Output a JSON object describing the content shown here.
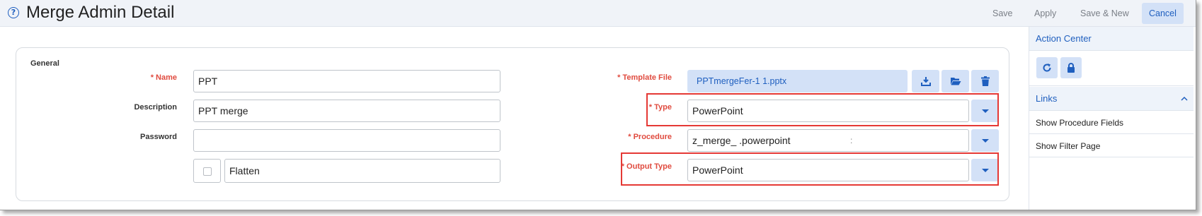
{
  "header": {
    "title": "Merge Admin Detail",
    "help_icon": "help-circle-icon",
    "buttons": {
      "save": "Save",
      "apply": "Apply",
      "save_new": "Save & New",
      "cancel": "Cancel"
    }
  },
  "general": {
    "section_title": "General",
    "name": {
      "label": "* Name",
      "value": "PPT"
    },
    "description": {
      "label": "Description",
      "value": "PPT merge"
    },
    "password": {
      "label": "Password",
      "value": ""
    },
    "flatten": {
      "label": "Flatten",
      "checked": false
    }
  },
  "template": {
    "template_file": {
      "label": "* Template File",
      "value": "PPTmergeFer-1 1.pptx"
    },
    "type": {
      "label": "* Type",
      "value": "PowerPoint"
    },
    "procedure": {
      "label": "* Procedure",
      "value": "z_merge_ .powerpoint",
      "suffix": ":"
    },
    "output_type": {
      "label": "* Output Type",
      "value": "PowerPoint"
    },
    "file_actions": [
      "download-icon",
      "folder-open-icon",
      "trash-icon"
    ]
  },
  "action_center": {
    "title": "Action Center",
    "buttons": [
      "refresh-icon",
      "lock-icon"
    ]
  },
  "links": {
    "title": "Links",
    "items": [
      "Show Procedure Fields",
      "Show Filter Page"
    ]
  },
  "colors": {
    "accent": "#1f5fbf",
    "accent_light": "#d3e1f7",
    "required": "#e04b3f",
    "highlight": "#e53935"
  }
}
